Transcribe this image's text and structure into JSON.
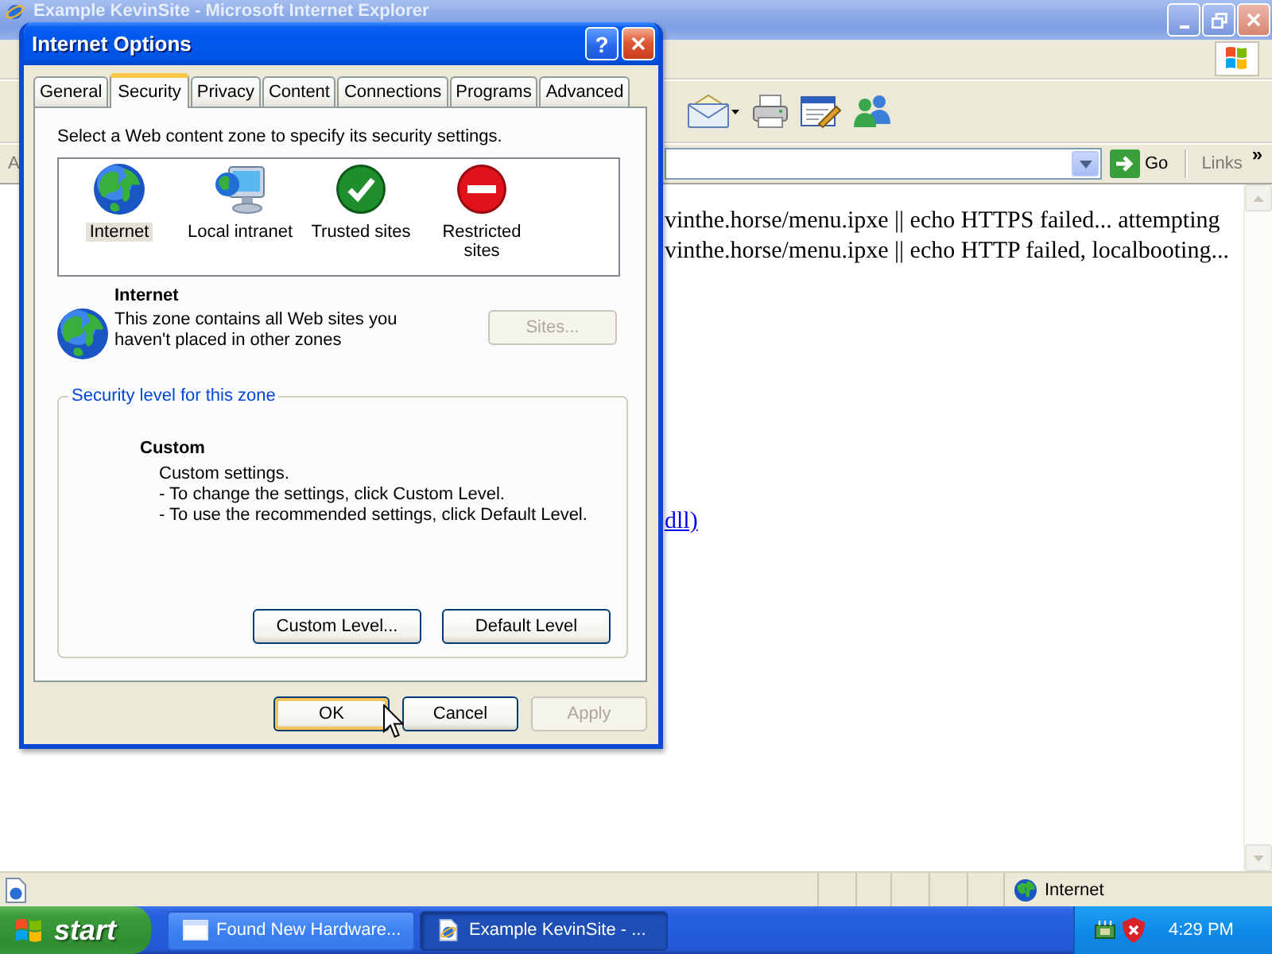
{
  "browser": {
    "title": "Example KevinSite - Microsoft Internet Explorer",
    "address_label": "A",
    "go_button": "Go",
    "links_label": "Links",
    "links_chevron": "»",
    "page_lines": [
      "vinthe.horse/menu.ipxe || echo HTTPS failed... attempting",
      "vinthe.horse/menu.ipxe || echo HTTP failed, localbooting..."
    ],
    "page_link": "dll)",
    "status_zone": "Internet"
  },
  "dialog": {
    "title": "Internet Options",
    "help_button": "?",
    "tabs": [
      {
        "label": "General",
        "selected": false
      },
      {
        "label": "Security",
        "selected": true
      },
      {
        "label": "Privacy",
        "selected": false
      },
      {
        "label": "Content",
        "selected": false
      },
      {
        "label": "Connections",
        "selected": false
      },
      {
        "label": "Programs",
        "selected": false
      },
      {
        "label": "Advanced",
        "selected": false
      }
    ],
    "zone_prompt": "Select a Web content zone to specify its security settings.",
    "zones": [
      {
        "kind": "internet",
        "label": "Internet",
        "selected": true
      },
      {
        "kind": "intranet",
        "label": "Local intranet",
        "selected": false
      },
      {
        "kind": "trusted",
        "label": "Trusted sites",
        "selected": false
      },
      {
        "kind": "restricted",
        "label": "Restricted sites",
        "selected": false
      }
    ],
    "zone_info": {
      "kind": "internet",
      "name": "Internet",
      "description": "This zone contains all Web sites you haven't placed in other zones",
      "sites_button": {
        "label": "Sites...",
        "disabled": true
      }
    },
    "security_level": {
      "group_label": "Security level for this zone",
      "name": "Custom",
      "lines": [
        "Custom settings.",
        "- To change the settings, click Custom Level.",
        "- To use the recommended settings, click Default Level."
      ],
      "buttons": [
        {
          "label": "Custom Level...",
          "disabled": false
        },
        {
          "label": "Default Level",
          "disabled": false
        }
      ]
    },
    "buttons": [
      {
        "label": "OK",
        "default": true,
        "disabled": false
      },
      {
        "label": "Cancel",
        "default": false,
        "disabled": false
      },
      {
        "label": "Apply",
        "default": false,
        "disabled": true
      }
    ]
  },
  "taskbar": {
    "start": "start",
    "items": [
      {
        "kind": "window",
        "label": "Found New Hardware...",
        "selected": false
      },
      {
        "kind": "browser",
        "label": "Example KevinSite - ...",
        "selected": true
      }
    ],
    "clock": "4:29 PM"
  }
}
